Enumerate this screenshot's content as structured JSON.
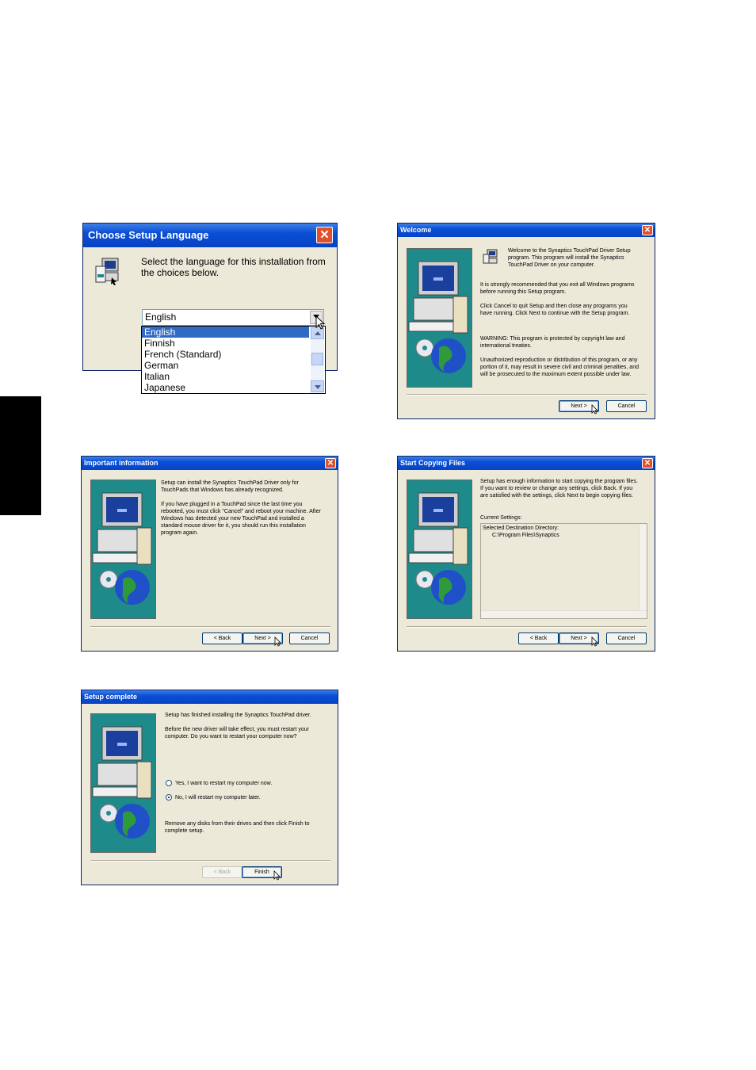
{
  "lang_dialog": {
    "title": "Choose Setup Language",
    "prompt": "Select the language for this installation from\nthe choices below.",
    "selected": "English",
    "options": [
      "English",
      "Finnish",
      "French (Standard)",
      "German",
      "Italian",
      "Japanese"
    ]
  },
  "welcome": {
    "title": "Welcome",
    "p1": "Welcome to the Synaptics TouchPad Driver Setup\nprogram.  This program will install the Synaptics\nTouchPad Driver on your computer.",
    "p2": "It is strongly recommended that you exit all Windows programs\nbefore running this Setup program.",
    "p3": "Click Cancel to quit Setup and then close any programs you\nhave running.  Click Next to continue with the Setup program.",
    "p4": "WARNING: This program is protected by copyright law and\ninternational treaties.",
    "p5": "Unauthorized reproduction or distribution of this program, or any\nportion of it, may result in severe civil and criminal penalties, and\nwill be prosecuted to the maximum extent possible under law.",
    "next": "Next >",
    "cancel": "Cancel"
  },
  "important": {
    "title": "Important information",
    "p1": "Setup can install the Synaptics TouchPad Driver only for\nTouchPads that Windows has already recognized.",
    "p2": "If you have plugged in a TouchPad since the last time you\nrebooted, you must click \"Cancel\" and reboot your machine. After\nWindows has detected your new TouchPad and installed a\nstandard mouse driver for it, you should run this installation\nprogram again.",
    "back": "< Back",
    "next": "Next >",
    "cancel": "Cancel"
  },
  "copying": {
    "title": "Start Copying Files",
    "p1": "Setup has enough information to start copying the program files.\nIf you want to review or change any settings, click Back.  If you\nare satisfied with the settings, click Next to begin copying files.",
    "current_label": "Current Settings:",
    "settings_line1": "Selected Destination Directory:",
    "settings_line2": "C:\\Program Files\\Synaptics",
    "back": "< Back",
    "next": "Next >",
    "cancel": "Cancel"
  },
  "complete": {
    "title": "Setup complete",
    "p1": "Setup has finished installing the Synaptics TouchPad driver.",
    "p2": "Before the new driver will take effect, you must restart your\ncomputer.  Do you want to restart your computer now?",
    "opt_yes": "Yes, I want to restart my computer now.",
    "opt_no": "No, I will restart my computer later.",
    "p3": "Remove any disks from their drives and then click Finish to\ncomplete setup.",
    "back": "< Back",
    "finish": "Finish"
  }
}
